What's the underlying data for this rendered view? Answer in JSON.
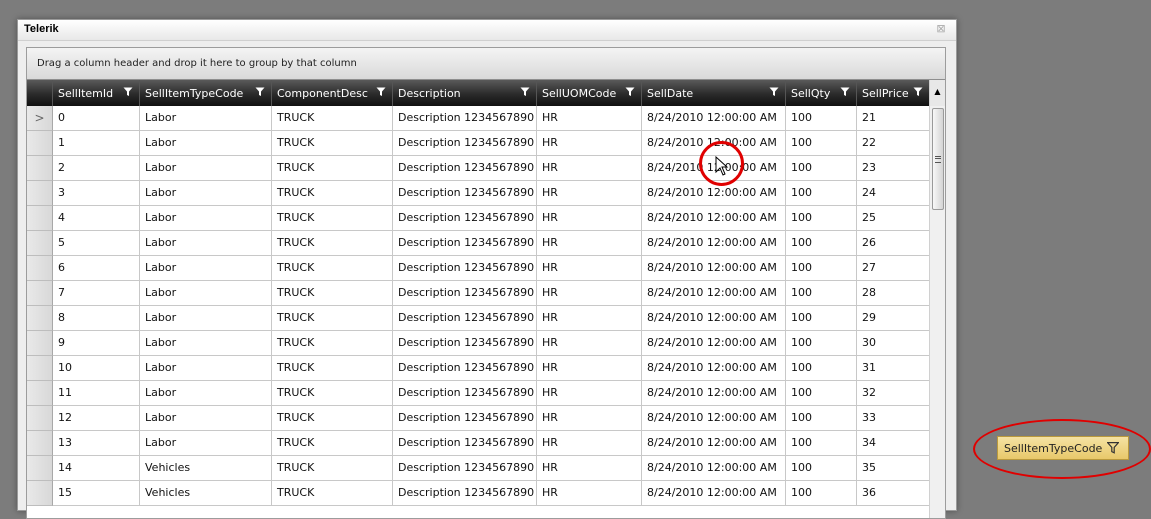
{
  "window": {
    "title": "Telerik",
    "close_glyph": "⊠"
  },
  "group_panel": {
    "hint": "Drag a column header and drop it here to group by that column"
  },
  "columns": [
    {
      "label": "SellItemId"
    },
    {
      "label": "SellItemTypeCode"
    },
    {
      "label": "ComponentDesc"
    },
    {
      "label": "Description"
    },
    {
      "label": "SellUOMCode"
    },
    {
      "label": "SellDate"
    },
    {
      "label": "SellQty"
    },
    {
      "label": "SellPrice"
    }
  ],
  "current_row_glyph": ">",
  "rows": [
    [
      "0",
      "Labor",
      "TRUCK",
      "Description 1234567890",
      "HR",
      "8/24/2010 12:00:00 AM",
      "100",
      "21"
    ],
    [
      "1",
      "Labor",
      "TRUCK",
      "Description 1234567890",
      "HR",
      "8/24/2010 12:00:00 AM",
      "100",
      "22"
    ],
    [
      "2",
      "Labor",
      "TRUCK",
      "Description 1234567890",
      "HR",
      "8/24/2010 12:00:00 AM",
      "100",
      "23"
    ],
    [
      "3",
      "Labor",
      "TRUCK",
      "Description 1234567890",
      "HR",
      "8/24/2010 12:00:00 AM",
      "100",
      "24"
    ],
    [
      "4",
      "Labor",
      "TRUCK",
      "Description 1234567890",
      "HR",
      "8/24/2010 12:00:00 AM",
      "100",
      "25"
    ],
    [
      "5",
      "Labor",
      "TRUCK",
      "Description 1234567890",
      "HR",
      "8/24/2010 12:00:00 AM",
      "100",
      "26"
    ],
    [
      "6",
      "Labor",
      "TRUCK",
      "Description 1234567890",
      "HR",
      "8/24/2010 12:00:00 AM",
      "100",
      "27"
    ],
    [
      "7",
      "Labor",
      "TRUCK",
      "Description 1234567890",
      "HR",
      "8/24/2010 12:00:00 AM",
      "100",
      "28"
    ],
    [
      "8",
      "Labor",
      "TRUCK",
      "Description 1234567890",
      "HR",
      "8/24/2010 12:00:00 AM",
      "100",
      "29"
    ],
    [
      "9",
      "Labor",
      "TRUCK",
      "Description 1234567890",
      "HR",
      "8/24/2010 12:00:00 AM",
      "100",
      "30"
    ],
    [
      "10",
      "Labor",
      "TRUCK",
      "Description 1234567890",
      "HR",
      "8/24/2010 12:00:00 AM",
      "100",
      "31"
    ],
    [
      "11",
      "Labor",
      "TRUCK",
      "Description 1234567890",
      "HR",
      "8/24/2010 12:00:00 AM",
      "100",
      "32"
    ],
    [
      "12",
      "Labor",
      "TRUCK",
      "Description 1234567890",
      "HR",
      "8/24/2010 12:00:00 AM",
      "100",
      "33"
    ],
    [
      "13",
      "Labor",
      "TRUCK",
      "Description 1234567890",
      "HR",
      "8/24/2010 12:00:00 AM",
      "100",
      "34"
    ],
    [
      "14",
      "Vehicles",
      "TRUCK",
      "Description 1234567890",
      "HR",
      "8/24/2010 12:00:00 AM",
      "100",
      "35"
    ],
    [
      "15",
      "Vehicles",
      "TRUCK",
      "Description 1234567890",
      "HR",
      "8/24/2010 12:00:00 AM",
      "100",
      "36"
    ]
  ],
  "drag_cue": {
    "label": "SellItemTypeCode"
  },
  "icons": {
    "column_filter": "filter-icon",
    "close": "close-icon",
    "current_row": "current-row-arrow-icon"
  },
  "colors": {
    "annotation": "#e00000",
    "drag_cue_fill": "#f0d789",
    "header_bg": "#2a2a2a"
  }
}
